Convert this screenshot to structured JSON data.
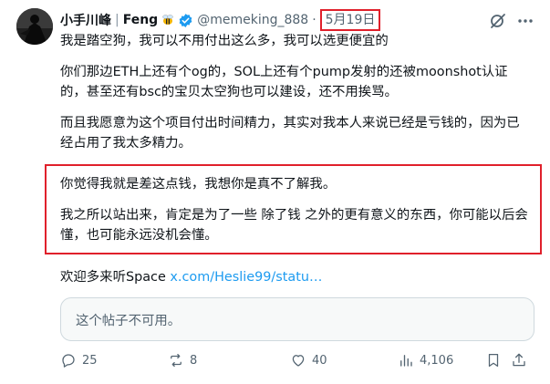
{
  "tweet": {
    "author_name": "小手川峰",
    "separator": "|",
    "author_suffix": "Feng",
    "handle": "@memeking_888",
    "dot": "·",
    "date": "5月19日",
    "paragraphs": [
      "我是踏空狗，我可以不用付出这么多，我可以选更便宜的",
      "你们那边ETH上还有个og的，SOL上还有个pump发射的还被moonshot认证的，甚至还有bsc的宝贝太空狗也可以建设，还不用挨骂。",
      "而且我愿意为这个项目付出时间精力，其实对我本人来说已经是亏钱的，因为已经占用了我太多精力。"
    ],
    "boxed_paragraphs": [
      "你觉得我就是差这点钱，我想你是真不了解我。",
      "我之所以站出来，肯定是为了一些 除了钱 之外的更有意义的东西，你可能以后会懂，也可能永远没机会懂。"
    ],
    "space_prefix": "欢迎多来听Space ",
    "space_link": "x.com/Heslie99/statu…",
    "unavailable_text": "这个帖子不可用。"
  },
  "actions": {
    "replies": "25",
    "reposts": "8",
    "likes": "40",
    "views": "4,106"
  },
  "colors": {
    "highlight_border": "#e0202b",
    "link": "#1d9bf0",
    "verified": "#1d9bf0",
    "muted": "#536471"
  }
}
